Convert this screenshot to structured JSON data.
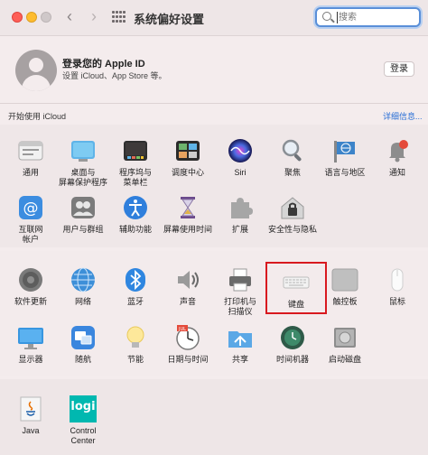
{
  "window": {
    "title": "系统偏好设置"
  },
  "search": {
    "placeholder": "搜索"
  },
  "account": {
    "title": "登录您的 Apple ID",
    "subtitle": "设置 iCloud、App Store 等。",
    "login_label": "登录",
    "icloud_label": "开始使用 iCloud",
    "details_link": "详细信息..."
  },
  "section1": [
    {
      "label": "通用",
      "icon": "general-icon"
    },
    {
      "label": "桌面与\n屏幕保护程序",
      "icon": "desktop-icon"
    },
    {
      "label": "程序坞与\n菜单栏",
      "icon": "dock-icon"
    },
    {
      "label": "调度中心",
      "icon": "mission-control-icon"
    },
    {
      "label": "Siri",
      "icon": "siri-icon"
    },
    {
      "label": "聚焦",
      "icon": "spotlight-icon"
    },
    {
      "label": "语言与地区",
      "icon": "language-icon"
    },
    {
      "label": "通知",
      "icon": "bell-icon"
    },
    {
      "label": "互联网\n帐户",
      "icon": "at-icon"
    },
    {
      "label": "用户与群组",
      "icon": "users-icon"
    },
    {
      "label": "辅助功能",
      "icon": "accessibility-icon"
    },
    {
      "label": "屏幕使用时间",
      "icon": "hourglass-icon"
    },
    {
      "label": "扩展",
      "icon": "puzzle-icon"
    },
    {
      "label": "安全性与隐私",
      "icon": "house-lock-icon"
    }
  ],
  "section2": [
    {
      "label": "软件更新",
      "icon": "software-update-icon"
    },
    {
      "label": "网络",
      "icon": "globe-icon"
    },
    {
      "label": "蓝牙",
      "icon": "bluetooth-icon"
    },
    {
      "label": "声音",
      "icon": "speaker-icon"
    },
    {
      "label": "打印机与\n扫描仪",
      "icon": "printer-icon"
    },
    {
      "label": "键盘",
      "icon": "keyboard-icon"
    },
    {
      "label": "触控板",
      "icon": "trackpad-icon"
    },
    {
      "label": "鼠标",
      "icon": "mouse-icon"
    },
    {
      "label": "显示器",
      "icon": "display-icon"
    },
    {
      "label": "随航",
      "icon": "sidecar-icon"
    },
    {
      "label": "节能",
      "icon": "bulb-icon"
    },
    {
      "label": "日期与时间",
      "icon": "clock-icon"
    },
    {
      "label": "共享",
      "icon": "sharing-icon"
    },
    {
      "label": "时间机器",
      "icon": "time-machine-icon"
    },
    {
      "label": "启动磁盘",
      "icon": "disk-icon"
    }
  ],
  "section3": [
    {
      "label": "Java",
      "icon": "java-icon"
    },
    {
      "label": "Control Center",
      "icon": "logi-icon",
      "logo_text": "logi"
    }
  ],
  "colors": {
    "accent": "#2a6fd6",
    "highlight": "#d8191f"
  }
}
